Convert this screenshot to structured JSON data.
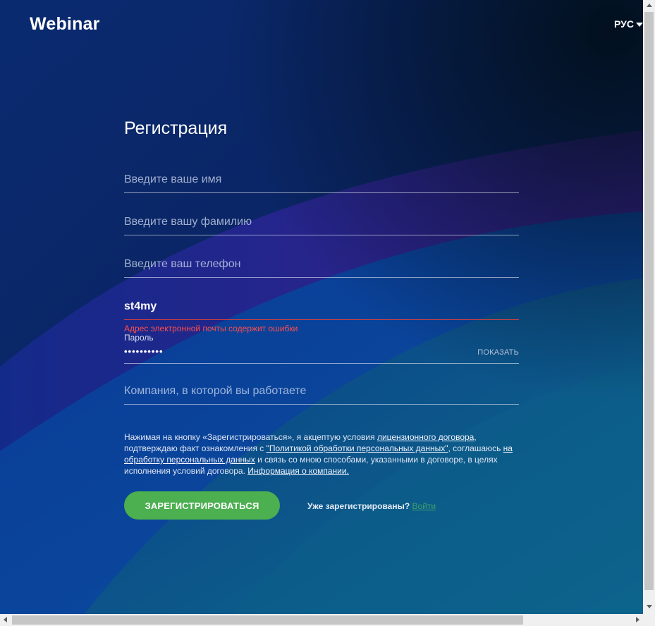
{
  "header": {
    "logo": "Webinar",
    "language": "РУС"
  },
  "form": {
    "title": "Регистрация",
    "first_name": {
      "placeholder": "Введите ваше имя",
      "value": ""
    },
    "last_name": {
      "placeholder": "Введите вашу фамилию",
      "value": ""
    },
    "phone": {
      "placeholder": "Введите ваш телефон",
      "value": ""
    },
    "email": {
      "value": "st4my",
      "error": "Адрес электронной почты содержит ошибки"
    },
    "password": {
      "label": "Пароль",
      "value": "••••••••••",
      "show_label": "ПОКАЗАТЬ"
    },
    "company": {
      "placeholder": "Компания, в которой вы работаете",
      "value": ""
    }
  },
  "legal": {
    "text_1": "Нажимая на кнопку «Зарегистрироваться», я акцептую условия ",
    "link_license": "лицензионного договора",
    "text_2": ", подтверждаю факт ознакомления с ",
    "link_policy": "\"Политикой обработки персональных данных\"",
    "text_3": ", соглашаюсь ",
    "link_consent": "на обработку персональных данных",
    "text_4": " и связь со мною способами, указанными в договоре, в целях исполнения условий договора. ",
    "link_company": "Информация о компании."
  },
  "actions": {
    "register_label": "ЗАРЕГИСТРИРОВАТЬСЯ",
    "already_text": "Уже зарегистрированы?",
    "login_label": "Войти"
  },
  "colors": {
    "accent_green": "#4caf50",
    "error_red": "#d8413e",
    "login_link": "#3ea06a"
  },
  "icons": {
    "language_caret": "caret-down"
  }
}
